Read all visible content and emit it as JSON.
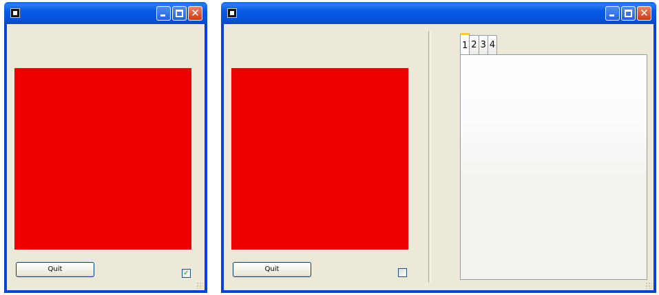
{
  "left_window": {
    "quit_label": "Quit",
    "checkbox_mark": "✓",
    "checkbox_checked": true,
    "panel_color": "#ee0000"
  },
  "right_window": {
    "quit_label": "Quit",
    "checkbox_checked": false,
    "panel_color": "#ee0000",
    "tabs": [
      {
        "label": "1",
        "active": true
      },
      {
        "label": "2",
        "active": false
      },
      {
        "label": "3",
        "active": false
      },
      {
        "label": "4",
        "active": false
      }
    ]
  },
  "titlebar": {
    "close_glyph": "✕",
    "accent": "#0842d8",
    "close_color": "#cc3b12"
  }
}
